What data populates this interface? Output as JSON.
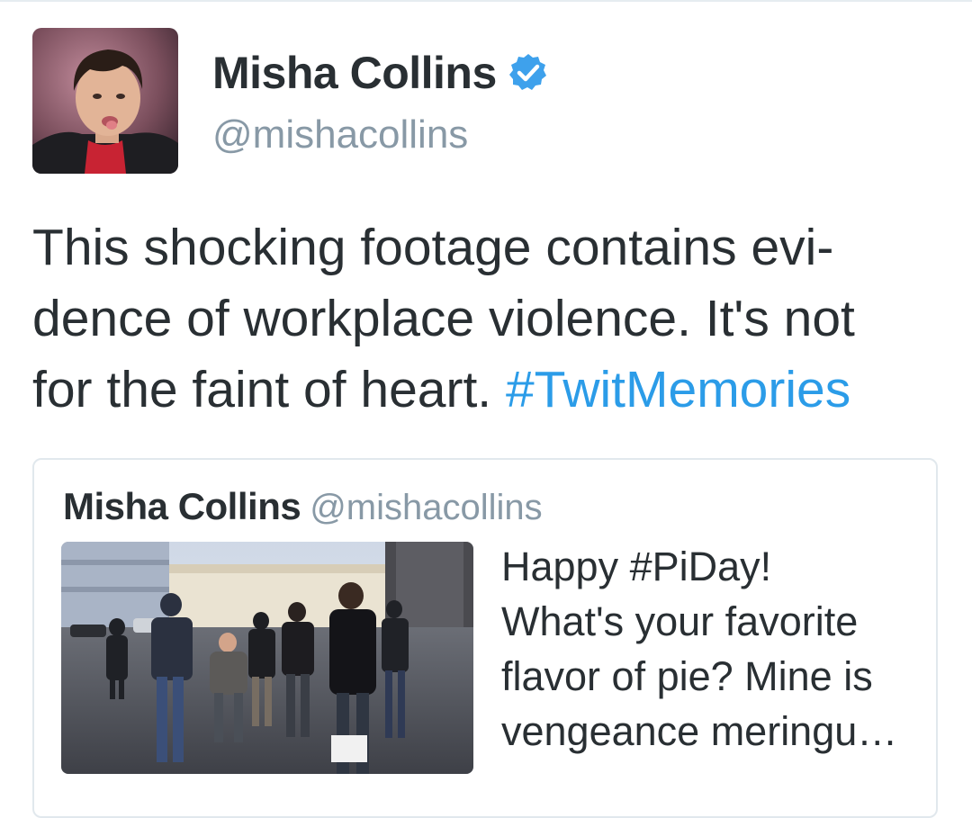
{
  "author": {
    "name": "Misha Collins",
    "handle": "@mishacollins",
    "verified": true,
    "avatar_icon": "profile-photo"
  },
  "tweet": {
    "lines": [
      "This shocking footage contains evi-",
      "dence of workplace violence. It's not",
      "for the faint of heart. "
    ],
    "hashtag": "#TwitMemories"
  },
  "quoted_tweet": {
    "name": "Misha Collins",
    "handle": "@mishacollins",
    "media_icon": "video-thumbnail",
    "text_lines": [
      "Happy #PiDay!",
      "What's your favorite",
      "flavor of pie? Mine is",
      "vengeance meringu…"
    ]
  },
  "colors": {
    "text": "#292f33",
    "secondary": "#8899a6",
    "link": "#2b9ce8",
    "verified_badge": "#3ea1ec",
    "border": "#e1e8ed"
  }
}
